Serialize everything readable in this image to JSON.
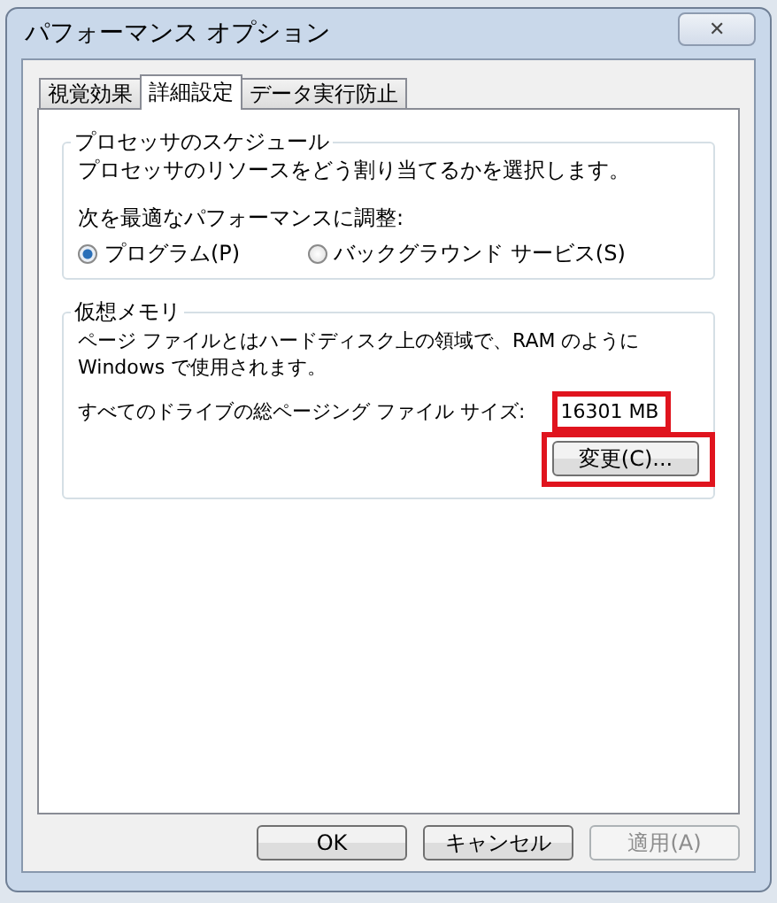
{
  "window": {
    "title": "パフォーマンス オプション",
    "close": "✕"
  },
  "tabs": [
    {
      "label": "視覚効果",
      "selected": false
    },
    {
      "label": "詳細設定",
      "selected": true
    },
    {
      "label": "データ実行防止",
      "selected": false
    }
  ],
  "processor_scheduling": {
    "title": "プロセッサのスケジュール",
    "description": "プロセッサのリソースをどう割り当てるかを選択します。",
    "adjust_label": "次を最適なパフォーマンスに調整:",
    "options": [
      {
        "label": "プログラム(P)",
        "selected": true
      },
      {
        "label": "バックグラウンド サービス(S)",
        "selected": false
      }
    ]
  },
  "virtual_memory": {
    "title": "仮想メモリ",
    "description": "ページ ファイルとはハードディスク上の領域で、RAM のように Windows で使用されます。",
    "size_label": "すべてのドライブの総ページング ファイル サイズ:",
    "size_value": "16301 MB",
    "size_highlighted": true,
    "change_button": "変更(C)...",
    "change_highlighted": true
  },
  "buttons": [
    {
      "label": "OK",
      "disabled": false
    },
    {
      "label": "キャンセル",
      "disabled": false
    },
    {
      "label": "適用(A)",
      "disabled": true
    }
  ]
}
